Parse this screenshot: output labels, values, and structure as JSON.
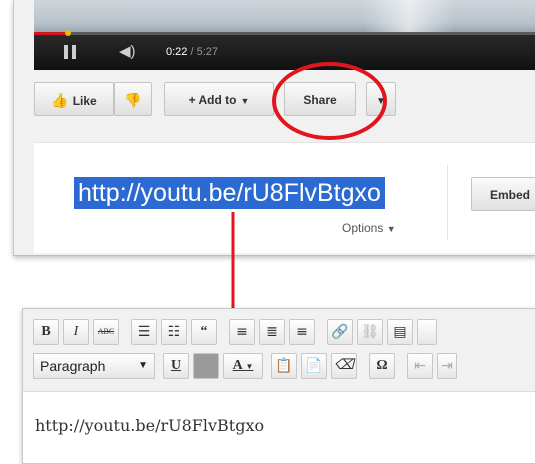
{
  "player": {
    "time_current": "0:22",
    "time_separator": " / ",
    "time_duration": "5:27",
    "progress_fraction": 0.067
  },
  "actions": {
    "like_label": "Like",
    "add_to_label": "+ Add to",
    "share_label": "Share"
  },
  "share": {
    "url": "http://youtu.be/rU8FlvBtgxo",
    "options_label": "Options",
    "embed_label": "Embed"
  },
  "editor": {
    "format_select": "Paragraph",
    "content_text": "http://youtu.be/rU8FlvBtgxo"
  },
  "colors": {
    "highlight": "#e0161c",
    "selection": "#2a6ad2"
  }
}
